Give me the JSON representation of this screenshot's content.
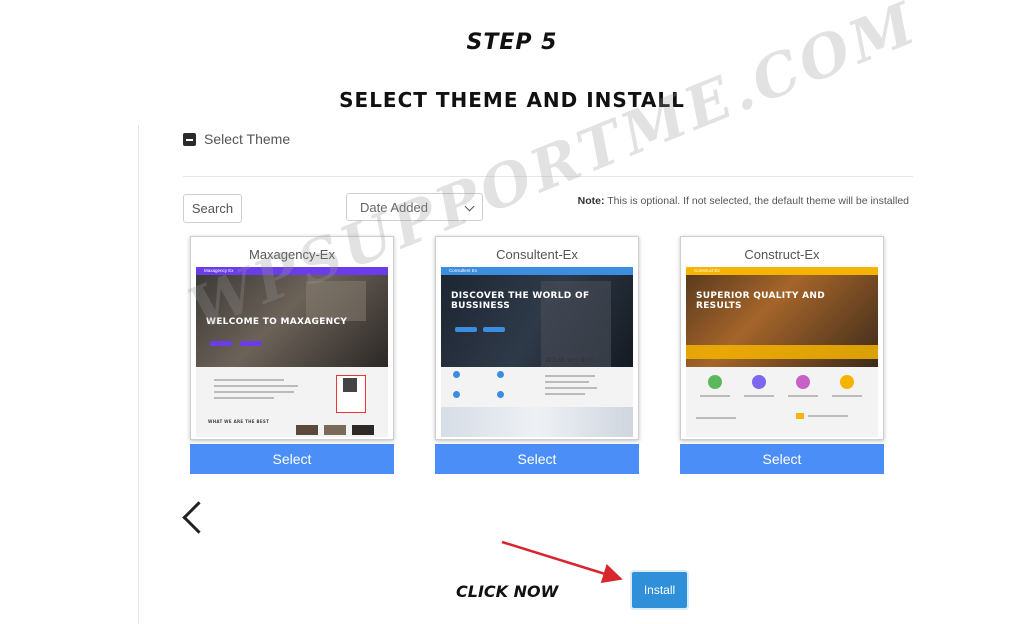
{
  "header": {
    "step": "STEP 5",
    "subtitle": "SELECT THEME AND INSTALL"
  },
  "panel": {
    "section_label": "Select Theme",
    "search_label": "Search",
    "sort_value": "Date Added",
    "note_label": "Note:",
    "note_text": " This is optional. If not selected, the default theme will be installed"
  },
  "themes": [
    {
      "name": "Maxagency-Ex",
      "select_label": "Select",
      "thumb": {
        "brand": "Maxagency Ex",
        "headline": "WELCOME TO MAXAGENCY",
        "about_heading": "WHAT WE ARE THE BEST",
        "accent": "#6a3de8"
      }
    },
    {
      "name": "Consultent-Ex",
      "select_label": "Select",
      "thumb": {
        "brand": "Consultent Ex",
        "headline": "DISCOVER THE WORLD OF BUSSINESS",
        "about_heading": "What we do?",
        "accent": "#3b8de0"
      }
    },
    {
      "name": "Construct-Ex",
      "select_label": "Select",
      "thumb": {
        "brand": "Construct Ex",
        "headline": "SUPERIOR QUALITY AND RESULTS",
        "accent": "#f5b400"
      }
    }
  ],
  "nav": {
    "prev_icon": "chevron-left-icon"
  },
  "cta": {
    "click_now": "CLICK NOW",
    "install_label": "Install"
  },
  "watermark": "WPSUPPORTME.COM",
  "colors": {
    "select_button": "#4c8ef7",
    "install_button": "#2f8fd8",
    "arrow": "#d8262e"
  }
}
